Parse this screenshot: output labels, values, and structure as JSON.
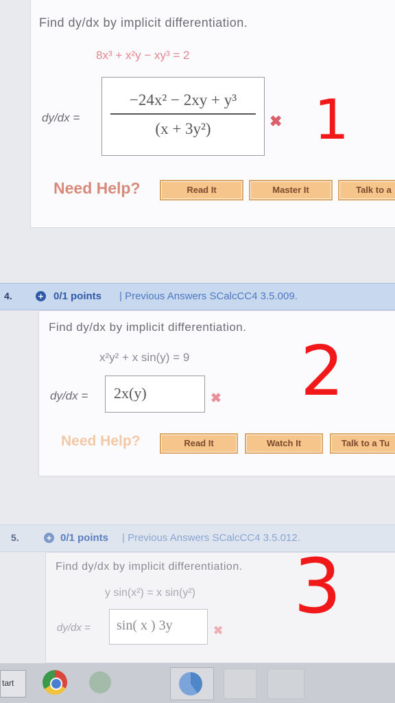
{
  "q3": {
    "prompt": "Find dy/dx by implicit differentiation.",
    "equation": "8x³ + x²y − xy³ = 2",
    "answer_label": "dy/dx =",
    "answer_numerator": "−24x² − 2xy + y³",
    "answer_denominator": "(x + 3y²)",
    "wrong_mark": "✖",
    "need_help": "Need Help?",
    "buttons": [
      "Read It",
      "Master It",
      "Talk to a"
    ]
  },
  "q4": {
    "number": "4.",
    "points": "0/1 points",
    "meta": "| Previous Answers  SCalcCC4 3.5.009.",
    "prompt": "Find dy/dx by implicit differentiation.",
    "equation": "x²y² + x sin(y) = 9",
    "answer_label": "dy/dx =",
    "answer_value": "2x(y)",
    "wrong_mark": "✖",
    "need_help": "Need Help?",
    "buttons": [
      "Read It",
      "Watch It",
      "Talk to a Tu"
    ]
  },
  "q5": {
    "number": "5.",
    "points": "0/1 points",
    "meta": "| Previous Answers  SCalcCC4 3.5.012.",
    "prompt": "Find dy/dx by implicit differentiation.",
    "equation": "y sin(x²) = x sin(y²)",
    "answer_label": "dy/dx =",
    "answer_value": "sin( x ) 3y",
    "wrong_mark": "✖"
  },
  "annotations": [
    "1",
    "2",
    "3"
  ],
  "taskbar": {
    "start_label": "tart"
  }
}
